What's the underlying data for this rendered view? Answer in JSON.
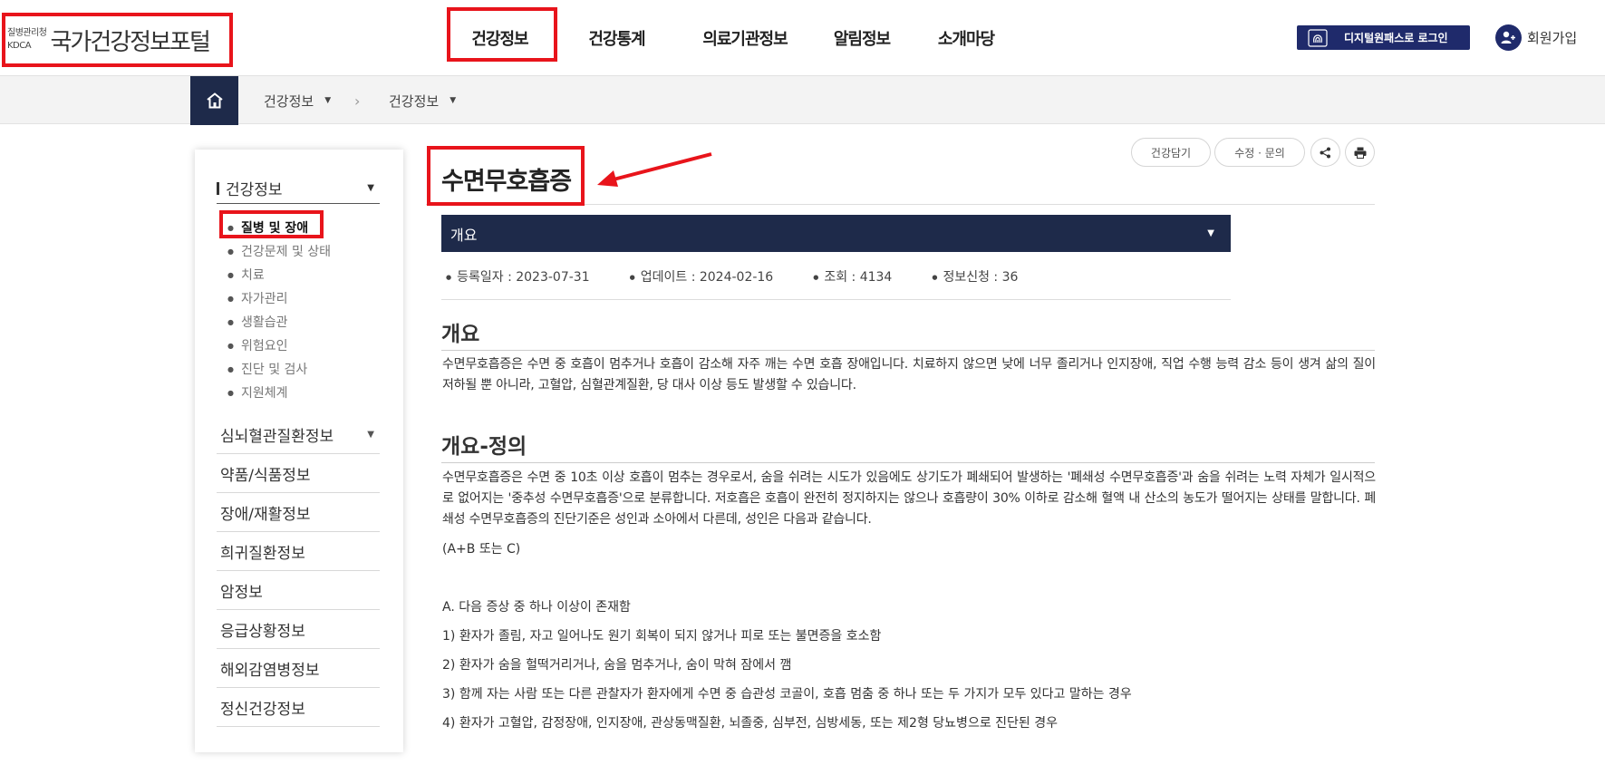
{
  "header": {
    "logo_small_1": "질병관리청",
    "logo_small_2": "KDCA",
    "logo_text": "국가건강정보포털",
    "nav": [
      "건강정보",
      "건강통계",
      "의료기관정보",
      "알림정보",
      "소개마당"
    ],
    "digital_login": "디지털원패스로 로그인",
    "join": "회원가입"
  },
  "breadcrumb": {
    "level1": "건강정보",
    "level2": "건강정보"
  },
  "sidebar": {
    "head": "건강정보",
    "subitems": [
      "질병 및 장애",
      "건강문제 및 상태",
      "치료",
      "자가관리",
      "생활습관",
      "위험요인",
      "진단 및 검사",
      "지원체계"
    ],
    "items": [
      "심뇌혈관질환정보",
      "약품/식품정보",
      "장애/재활정보",
      "희귀질환정보",
      "암정보",
      "응급상황정보",
      "해외감염병정보",
      "정신건강정보"
    ]
  },
  "toolbar": {
    "bookmark": "건강담기",
    "edit": "수정 · 문의"
  },
  "page": {
    "title": "수면무호흡증",
    "accordion": "개요",
    "meta": {
      "registered": "등록일자 : 2023-07-31",
      "updated": "업데이트 : 2024-02-16",
      "views": "조회 : 4134",
      "requests": "정보신청 : 36"
    },
    "sections": [
      {
        "heading": "개요",
        "body": "수면무호흡증은 수면 중 호흡이 멈추거나 호흡이 감소해 자주 깨는 수면 호흡 장애입니다. 치료하지 않으면 낮에 너무 졸리거나 인지장애, 직업 수행 능력 감소 등이 생겨 삶의 질이 저하될 뿐 아니라, 고혈압, 심혈관계질환, 당 대사 이상 등도 발생할 수 있습니다."
      },
      {
        "heading": "개요-정의",
        "body": "수면무호흡증은 수면 중 10초 이상 호흡이 멈추는 경우로서, 숨을 쉬려는 시도가 있음에도 상기도가 폐쇄되어 발생하는 '폐쇄성 수면무호흡증'과 숨을 쉬려는 노력 자체가 일시적으로 없어지는 '중추성 수면무호흡증'으로 분류합니다. 저호흡은 호흡이 완전히 정지하지는 않으나 호흡량이 30% 이하로 감소해 혈액 내 산소의 농도가 떨어지는 상태를 말합니다. 폐쇄성 수면무호흡증의 진단기준은 성인과 소아에서 다른데, 성인은 다음과 같습니다."
      }
    ],
    "criteria_intro": "(A+B 또는 C)",
    "criteria_a": "A. 다음 증상 중 하나 이상이 존재함",
    "criteria_items": [
      "1) 환자가 졸림, 자고 일어나도 원기 회복이 되지 않거나 피로 또는 불면증을 호소함",
      "2) 환자가 숨을 헐떡거리거나, 숨을 멈추거나, 숨이 막혀 잠에서 깸",
      "3) 함께 자는 사람 또는 다른 관찰자가 환자에게 수면 중 습관성 코골이, 호흡 멈춤 중 하나 또는 두 가지가 모두 있다고 말하는 경우",
      "4) 환자가 고혈압, 감정장애, 인지장애, 관상동맥질환, 뇌졸중, 심부전, 심방세동, 또는 제2형 당뇨병으로 진단된 경우"
    ]
  },
  "colors": {
    "navy": "#1e2a4a",
    "login_blue": "#1f2a6b",
    "highlight_red": "#e8141b"
  }
}
